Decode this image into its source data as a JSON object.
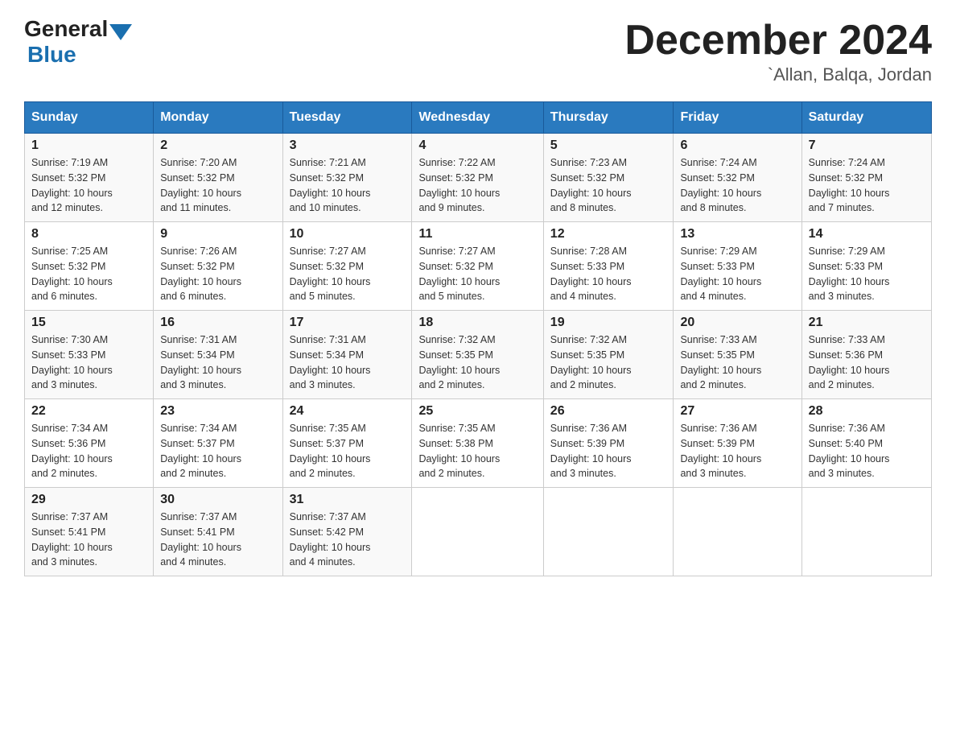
{
  "header": {
    "logo_general": "General",
    "logo_blue": "Blue",
    "month_title": "December 2024",
    "location": "`Allan, Balqa, Jordan"
  },
  "days_of_week": [
    "Sunday",
    "Monday",
    "Tuesday",
    "Wednesday",
    "Thursday",
    "Friday",
    "Saturday"
  ],
  "weeks": [
    [
      {
        "day": "1",
        "sunrise": "7:19 AM",
        "sunset": "5:32 PM",
        "daylight": "10 hours and 12 minutes."
      },
      {
        "day": "2",
        "sunrise": "7:20 AM",
        "sunset": "5:32 PM",
        "daylight": "10 hours and 11 minutes."
      },
      {
        "day": "3",
        "sunrise": "7:21 AM",
        "sunset": "5:32 PM",
        "daylight": "10 hours and 10 minutes."
      },
      {
        "day": "4",
        "sunrise": "7:22 AM",
        "sunset": "5:32 PM",
        "daylight": "10 hours and 9 minutes."
      },
      {
        "day": "5",
        "sunrise": "7:23 AM",
        "sunset": "5:32 PM",
        "daylight": "10 hours and 8 minutes."
      },
      {
        "day": "6",
        "sunrise": "7:24 AM",
        "sunset": "5:32 PM",
        "daylight": "10 hours and 8 minutes."
      },
      {
        "day": "7",
        "sunrise": "7:24 AM",
        "sunset": "5:32 PM",
        "daylight": "10 hours and 7 minutes."
      }
    ],
    [
      {
        "day": "8",
        "sunrise": "7:25 AM",
        "sunset": "5:32 PM",
        "daylight": "10 hours and 6 minutes."
      },
      {
        "day": "9",
        "sunrise": "7:26 AM",
        "sunset": "5:32 PM",
        "daylight": "10 hours and 6 minutes."
      },
      {
        "day": "10",
        "sunrise": "7:27 AM",
        "sunset": "5:32 PM",
        "daylight": "10 hours and 5 minutes."
      },
      {
        "day": "11",
        "sunrise": "7:27 AM",
        "sunset": "5:32 PM",
        "daylight": "10 hours and 5 minutes."
      },
      {
        "day": "12",
        "sunrise": "7:28 AM",
        "sunset": "5:33 PM",
        "daylight": "10 hours and 4 minutes."
      },
      {
        "day": "13",
        "sunrise": "7:29 AM",
        "sunset": "5:33 PM",
        "daylight": "10 hours and 4 minutes."
      },
      {
        "day": "14",
        "sunrise": "7:29 AM",
        "sunset": "5:33 PM",
        "daylight": "10 hours and 3 minutes."
      }
    ],
    [
      {
        "day": "15",
        "sunrise": "7:30 AM",
        "sunset": "5:33 PM",
        "daylight": "10 hours and 3 minutes."
      },
      {
        "day": "16",
        "sunrise": "7:31 AM",
        "sunset": "5:34 PM",
        "daylight": "10 hours and 3 minutes."
      },
      {
        "day": "17",
        "sunrise": "7:31 AM",
        "sunset": "5:34 PM",
        "daylight": "10 hours and 3 minutes."
      },
      {
        "day": "18",
        "sunrise": "7:32 AM",
        "sunset": "5:35 PM",
        "daylight": "10 hours and 2 minutes."
      },
      {
        "day": "19",
        "sunrise": "7:32 AM",
        "sunset": "5:35 PM",
        "daylight": "10 hours and 2 minutes."
      },
      {
        "day": "20",
        "sunrise": "7:33 AM",
        "sunset": "5:35 PM",
        "daylight": "10 hours and 2 minutes."
      },
      {
        "day": "21",
        "sunrise": "7:33 AM",
        "sunset": "5:36 PM",
        "daylight": "10 hours and 2 minutes."
      }
    ],
    [
      {
        "day": "22",
        "sunrise": "7:34 AM",
        "sunset": "5:36 PM",
        "daylight": "10 hours and 2 minutes."
      },
      {
        "day": "23",
        "sunrise": "7:34 AM",
        "sunset": "5:37 PM",
        "daylight": "10 hours and 2 minutes."
      },
      {
        "day": "24",
        "sunrise": "7:35 AM",
        "sunset": "5:37 PM",
        "daylight": "10 hours and 2 minutes."
      },
      {
        "day": "25",
        "sunrise": "7:35 AM",
        "sunset": "5:38 PM",
        "daylight": "10 hours and 2 minutes."
      },
      {
        "day": "26",
        "sunrise": "7:36 AM",
        "sunset": "5:39 PM",
        "daylight": "10 hours and 3 minutes."
      },
      {
        "day": "27",
        "sunrise": "7:36 AM",
        "sunset": "5:39 PM",
        "daylight": "10 hours and 3 minutes."
      },
      {
        "day": "28",
        "sunrise": "7:36 AM",
        "sunset": "5:40 PM",
        "daylight": "10 hours and 3 minutes."
      }
    ],
    [
      {
        "day": "29",
        "sunrise": "7:37 AM",
        "sunset": "5:41 PM",
        "daylight": "10 hours and 3 minutes."
      },
      {
        "day": "30",
        "sunrise": "7:37 AM",
        "sunset": "5:41 PM",
        "daylight": "10 hours and 4 minutes."
      },
      {
        "day": "31",
        "sunrise": "7:37 AM",
        "sunset": "5:42 PM",
        "daylight": "10 hours and 4 minutes."
      },
      null,
      null,
      null,
      null
    ]
  ],
  "labels": {
    "sunrise": "Sunrise:",
    "sunset": "Sunset:",
    "daylight": "Daylight:"
  }
}
